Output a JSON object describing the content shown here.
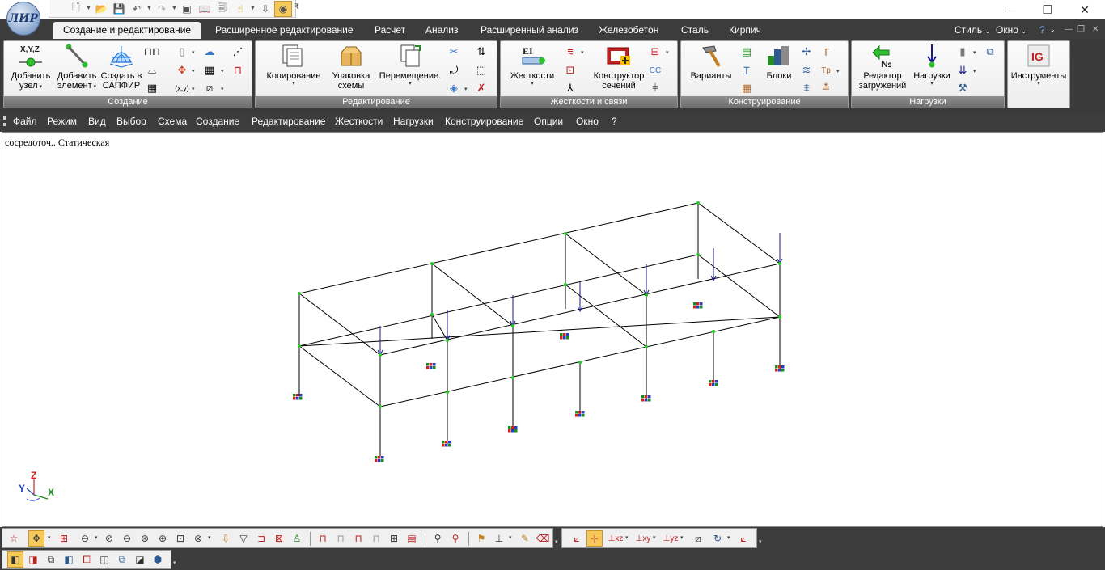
{
  "title_bar": {
    "logo_text": "ЛИР",
    "customize_glyph": "₹",
    "window_controls": [
      "—",
      "❐",
      "✕"
    ]
  },
  "tabs": [
    {
      "label": "Создание и редактирование",
      "active": true
    },
    {
      "label": "Расширенное редактирование",
      "active": false
    },
    {
      "label": "Расчет",
      "active": false
    },
    {
      "label": "Анализ",
      "active": false
    },
    {
      "label": "Расширенный анализ",
      "active": false
    },
    {
      "label": "Железобетон",
      "active": false
    },
    {
      "label": "Сталь",
      "active": false
    },
    {
      "label": "Кирпич",
      "active": false
    }
  ],
  "tab_right": {
    "style": "Стиль",
    "window": "Окно",
    "help": "?"
  },
  "ribbon": {
    "groups": {
      "create": {
        "label": "Создание",
        "buttons": [
          {
            "l1": "Добавить",
            "l2": "узел",
            "icon_text": "X,Y,Z"
          },
          {
            "l1": "Добавить",
            "l2": "элемент"
          },
          {
            "l1": "Создать в",
            "l2": "САПФИР"
          }
        ]
      },
      "edit": {
        "label": "Редактирование",
        "buttons": [
          {
            "l1": "Копирование",
            "l2": ""
          },
          {
            "l1": "Упаковка",
            "l2": "схемы"
          },
          {
            "l1": "Перемещение.",
            "l2": ""
          }
        ]
      },
      "stiff": {
        "label": "Жесткости и связи",
        "buttons": [
          {
            "l1": "Жесткости",
            "l2": "",
            "icon_text": "EI"
          },
          {
            "l1": "Конструктор",
            "l2": "сечений"
          }
        ]
      },
      "design": {
        "label": "Конструирование",
        "buttons": [
          {
            "l1": "Варианты",
            "l2": ""
          },
          {
            "l1": "Блоки",
            "l2": ""
          }
        ]
      },
      "loads": {
        "label": "Нагрузки",
        "buttons": [
          {
            "l1": "Редактор",
            "l2": "загружений"
          },
          {
            "l1": "Нагрузки",
            "l2": ""
          }
        ]
      },
      "tools": {
        "label": "",
        "buttons": [
          {
            "l1": "Инструменты",
            "l2": ""
          }
        ]
      }
    }
  },
  "menu": [
    "Файл",
    "Режим",
    "Вид",
    "Выбор",
    "Схема",
    "Создание",
    "Редактирование",
    "Жесткости",
    "Нагрузки",
    "Конструирование",
    "Опции",
    "Окно",
    "?"
  ],
  "workspace": {
    "load_case_label": "сосредоточ.. Статическая",
    "axes": {
      "x": "X",
      "y": "Y",
      "z": "Z"
    }
  },
  "colors": {
    "dark_bar": "#3c3c3c",
    "node": "#22cc22",
    "load_arrow": "#1a1a8a",
    "support_red": "#d42020",
    "support_green": "#1a8a1a",
    "support_blue": "#2040c0",
    "axis_x": "#1a8a1a",
    "axis_y": "#2040c0",
    "axis_z": "#d42020",
    "active_button": "#f5c95a"
  }
}
